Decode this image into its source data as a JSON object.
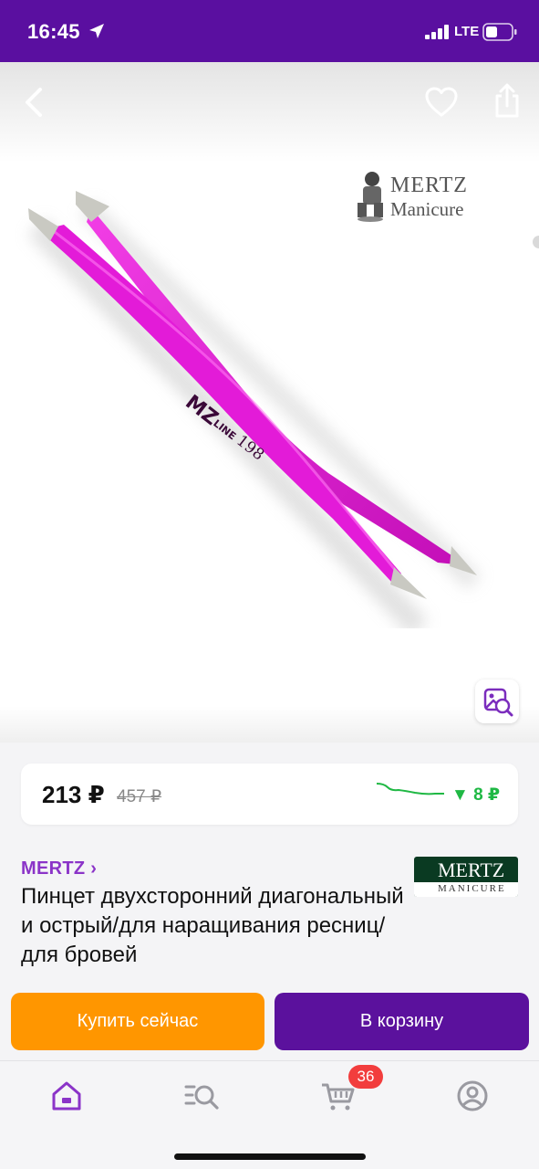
{
  "status_bar": {
    "time": "16:45",
    "network": "LTE",
    "icons": [
      "location-arrow-icon",
      "signal-icon",
      "battery-icon"
    ],
    "background": "#5a0fa0"
  },
  "gallery": {
    "watermark_line1": "MERTZ",
    "watermark_line2": "Manicure",
    "product_marking": "MZ LINE 198",
    "icons": [
      "back-icon",
      "heart-icon",
      "share-icon",
      "image-search-icon"
    ]
  },
  "price": {
    "current": "213 ₽",
    "old": "457 ₽",
    "drop": "▼ 8 ₽"
  },
  "product": {
    "brand": "MERTZ ›",
    "title": "Пинцет двухсторонний диагональный и острый/для наращивания ресниц/для бровей",
    "logo_line1": "MERTZ",
    "logo_line2": "MANICURE"
  },
  "actions": {
    "buy_now": "Купить сейчас",
    "add_to_cart": "В корзину"
  },
  "tab_bar": {
    "cart_badge": "36",
    "icons": [
      "home-icon",
      "catalog-search-icon",
      "cart-icon",
      "profile-icon"
    ]
  },
  "colors": {
    "brand_purple": "#5b119d",
    "orange": "#ff9600",
    "green": "#1fb844",
    "badge_red": "#f23d3d",
    "tweezer_pink": "#e01ad6"
  }
}
